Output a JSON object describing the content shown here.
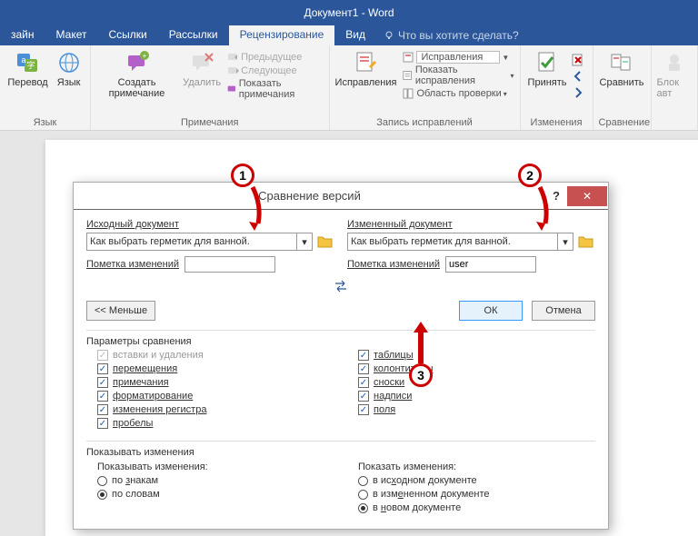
{
  "titlebar": "Документ1 - Word",
  "tabs": {
    "design": "зайн",
    "layout": "Макет",
    "references": "Ссылки",
    "mailings": "Рассылки",
    "review": "Рецензирование",
    "view": "Вид",
    "tellme": "Что вы хотите сделать?"
  },
  "ribbon": {
    "translate": "Перевод",
    "language": "Язык",
    "group_language": "Язык",
    "new_comment": "Создать примечание",
    "delete": "Удалить",
    "prev": "Предыдущее",
    "next": "Следующее",
    "show_comments": "Показать примечания",
    "group_comments": "Примечания",
    "tracking": "Исправления",
    "track_mode": "Исправления",
    "show_markup": "Показать исправления",
    "review_pane": "Область проверки",
    "group_tracking": "Запись исправлений",
    "accept": "Принять",
    "group_changes": "Изменения",
    "compare": "Сравнить",
    "group_compare": "Сравнение",
    "block": "Блок авт"
  },
  "dialog": {
    "title": "Сравнение версий",
    "help": "?",
    "close": "✕",
    "source_label": "Исходный документ",
    "changed_label": "Измененный документ",
    "doc_name": "Как выбрать герметик для ванной.",
    "mark_label": "Пометка изменений",
    "mark_left": "",
    "mark_right": "user",
    "less_btn": "<<  Меньше",
    "ok_btn": "ОК",
    "cancel_btn": "Отмена",
    "params_title": "Параметры сравнения",
    "cb_inserts": "вставки и удаления",
    "cb_moves": "перемещения",
    "cb_comments": "примечания",
    "cb_formatting": "форматирование",
    "cb_case": "изменения регистра",
    "cb_whitespace": "пробелы",
    "cb_tables": "таблицы",
    "cb_headers": "колонтитулы",
    "cb_footnotes": "сноски",
    "cb_captions": "надписи",
    "cb_fields": "поля",
    "show_title": "Показывать изменения",
    "show_changes_label": "Показывать изменения:",
    "by_chars": "по знакам",
    "by_words": "по словам",
    "show_in_label": "Показать изменения:",
    "in_source": "в исходном документе",
    "in_changed": "в измененном документе",
    "in_new": "в новом документе"
  },
  "markers": {
    "one": "1",
    "two": "2",
    "three": "3"
  }
}
